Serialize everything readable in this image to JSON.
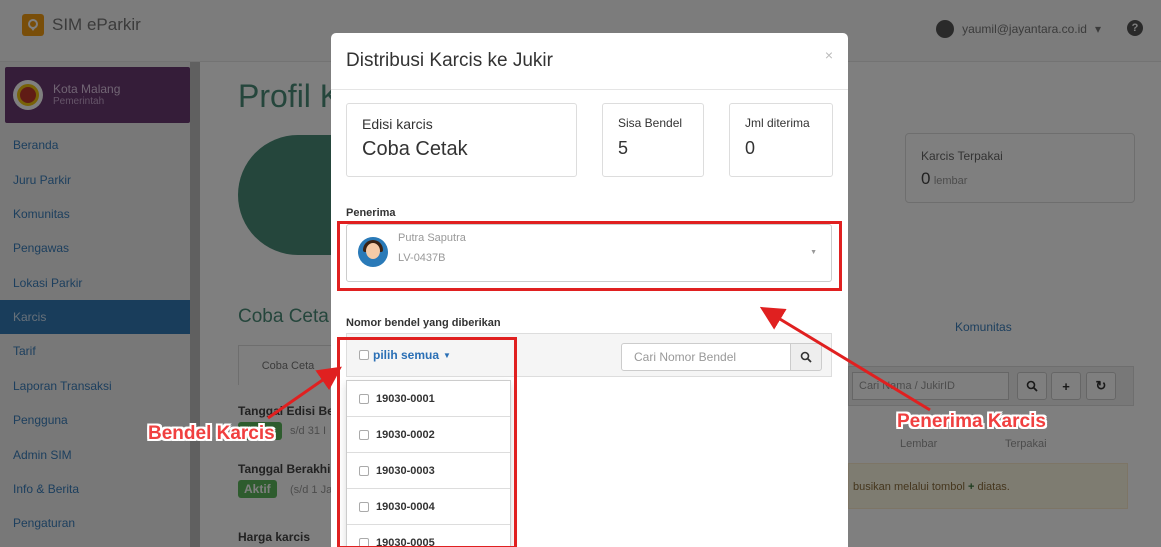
{
  "navbar": {
    "brand": "SIM eParkir",
    "user": "yaumil@jayantara.co.id",
    "caret": "▾",
    "help": "?"
  },
  "sidebar": {
    "org_name": "Kota Malang",
    "org_sub": "Pemerintah",
    "items": [
      {
        "label": "Beranda"
      },
      {
        "label": "Juru Parkir"
      },
      {
        "label": "Komunitas"
      },
      {
        "label": "Pengawas"
      },
      {
        "label": "Lokasi Parkir"
      },
      {
        "label": "Karcis"
      },
      {
        "label": "Tarif"
      },
      {
        "label": "Laporan Transaksi"
      },
      {
        "label": "Pengguna"
      },
      {
        "label": "Admin SIM"
      },
      {
        "label": "Info & Berita"
      },
      {
        "label": "Pengaturan"
      }
    ],
    "active": "Karcis"
  },
  "background": {
    "page_title": "Profil K",
    "card_label": "Karcis Terpakai",
    "card_value": "0",
    "card_unit": "lembar",
    "section_title": "Coba Ceta",
    "tab": "Coba Ceta",
    "tanggal_edisi": "Tanggal Edisi Be",
    "tanggal_edisi_sub": "s/d 31 I",
    "tanggal_berakhir": "Tanggal Berakhi",
    "aktif": "Aktif",
    "aktif_sub": "(s/d 1 Ja",
    "harga": "Harga karcis",
    "komunitas_tab": "Komunitas",
    "search_placeholder": "Cari Nama / JukirID",
    "lembar": "Lembar",
    "terpakai": "Terpakai",
    "alert": "busikan melalui tombol",
    "alert_tail": "diatas."
  },
  "modal": {
    "title": "Distribusi Karcis ke Jukir",
    "close": "×",
    "edisi_label": "Edisi karcis",
    "edisi_value": "Coba Cetak",
    "sisa_label": "Sisa Bendel",
    "sisa_value": "5",
    "jml_label": "Jml diterima",
    "jml_value": "0",
    "penerima_label": "Penerima",
    "penerima_name": "Putra Saputra",
    "penerima_id": "LV-0437B",
    "nomor_label": "Nomor bendel yang diberikan",
    "pilih_semua": "pilih semua",
    "cari_placeholder": "Cari Nomor Bendel",
    "bundles": [
      "19030-0001",
      "19030-0002",
      "19030-0003",
      "19030-0004",
      "19030-0005"
    ]
  },
  "annotations": {
    "bendel": "Bendel Karcis",
    "penerima": "Penerima Karcis",
    "color": "#e02020"
  }
}
